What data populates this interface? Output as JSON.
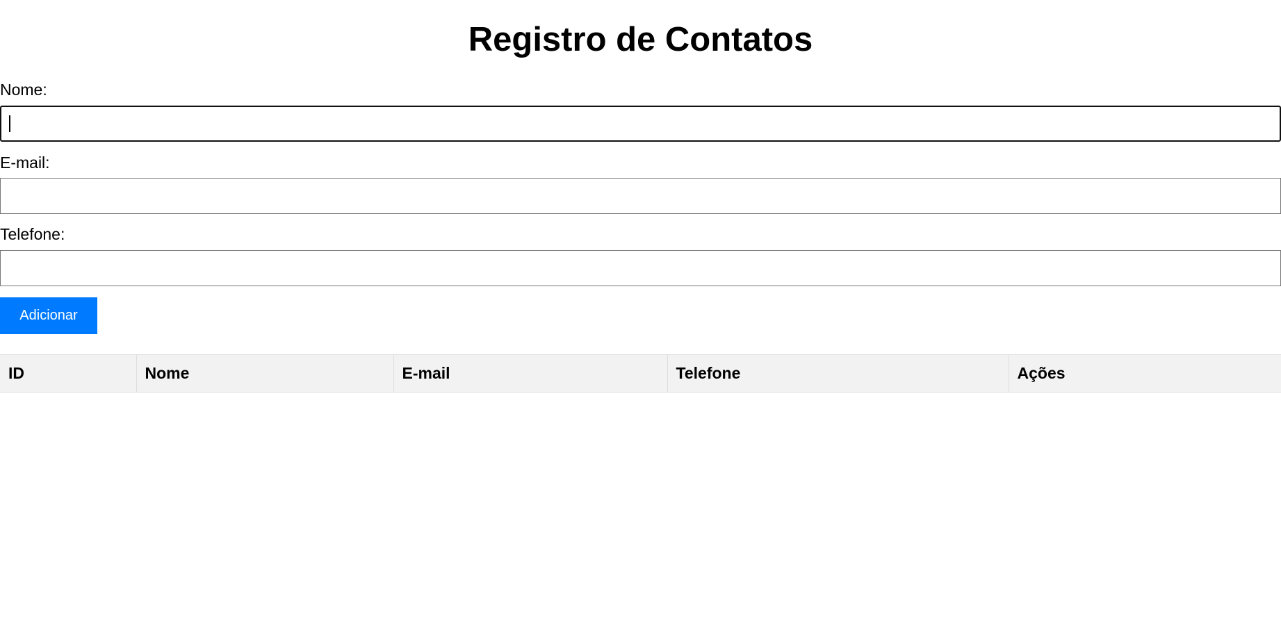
{
  "page": {
    "title": "Registro de Contatos"
  },
  "form": {
    "name_label": "Nome:",
    "name_value": "",
    "email_label": "E-mail:",
    "email_value": "",
    "phone_label": "Telefone:",
    "phone_value": "",
    "add_button_label": "Adicionar"
  },
  "table": {
    "headers": [
      "ID",
      "Nome",
      "E-mail",
      "Telefone",
      "Ações"
    ],
    "rows": []
  },
  "colors": {
    "accent": "#007bff",
    "table_header_bg": "#f2f2f2"
  }
}
